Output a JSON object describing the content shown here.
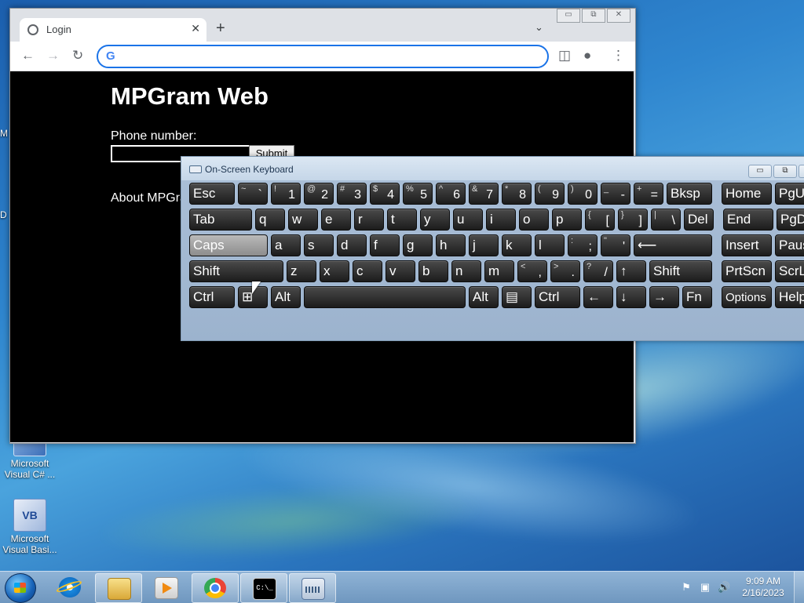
{
  "desktop": {
    "icons": [
      {
        "label": "Microsoft Visual C# ..."
      },
      {
        "label": "Microsoft Visual Basi..."
      }
    ],
    "vb_badge": "VB",
    "edge_letters": [
      "M",
      "D"
    ]
  },
  "browser": {
    "tab_title": "Login",
    "tab_close": "✕",
    "new_tab": "+",
    "tab_menu": "⌄",
    "window_buttons": {
      "minimize": "▭",
      "restore": "⧉",
      "close": "✕"
    },
    "nav": {
      "back": "←",
      "forward": "→",
      "reload": "↻"
    },
    "omnibox": {
      "g": "G",
      "value": ""
    },
    "toolbar_icons": {
      "sidebar": "◫",
      "profile": "●",
      "menu": "⋮"
    }
  },
  "page": {
    "title": "MPGram Web",
    "phone_label": "Phone number:",
    "submit": "Submit",
    "about": "About MPGram"
  },
  "osk": {
    "title": "On-Screen Keyboard",
    "buttons": {
      "minimize": "▭",
      "restore": "⧉"
    },
    "rows": [
      [
        {
          "label": "Esc",
          "w": 58
        },
        {
          "s": "~",
          "m": "`",
          "w": 38
        },
        {
          "s": "!",
          "m": "1",
          "w": 38
        },
        {
          "s": "@",
          "m": "2",
          "w": 38
        },
        {
          "s": "#",
          "m": "3",
          "w": 38
        },
        {
          "s": "$",
          "m": "4",
          "w": 38
        },
        {
          "s": "%",
          "m": "5",
          "w": 38
        },
        {
          "s": "^",
          "m": "6",
          "w": 38
        },
        {
          "s": "&",
          "m": "7",
          "w": 38
        },
        {
          "s": "*",
          "m": "8",
          "w": 38
        },
        {
          "s": "(",
          "m": "9",
          "w": 38
        },
        {
          "s": ")",
          "m": "0",
          "w": 38
        },
        {
          "s": "_",
          "m": "-",
          "w": 38
        },
        {
          "s": "+",
          "m": "=",
          "w": 38
        },
        {
          "label": "Bksp",
          "w": 58
        },
        {
          "label": "Home",
          "w": 64,
          "gap": 8
        },
        {
          "label": "PgUp",
          "w": 50
        }
      ],
      [
        {
          "label": "Tab",
          "w": 80
        },
        {
          "label": "q",
          "w": 38
        },
        {
          "label": "w",
          "w": 38
        },
        {
          "label": "e",
          "w": 38
        },
        {
          "label": "r",
          "w": 38
        },
        {
          "label": "t",
          "w": 38
        },
        {
          "label": "y",
          "w": 38
        },
        {
          "label": "u",
          "w": 38
        },
        {
          "label": "i",
          "w": 38
        },
        {
          "label": "o",
          "w": 38
        },
        {
          "label": "p",
          "w": 38
        },
        {
          "s": "{",
          "m": "[",
          "w": 38
        },
        {
          "s": "}",
          "m": "]",
          "w": 38
        },
        {
          "s": "|",
          "m": "\\",
          "w": 38
        },
        {
          "label": "Del",
          "w": 38
        },
        {
          "label": "End",
          "w": 64,
          "gap": 8
        },
        {
          "label": "PgDn",
          "w": 50
        }
      ],
      [
        {
          "label": "Caps",
          "w": 100,
          "dim": true
        },
        {
          "label": "a",
          "w": 38
        },
        {
          "label": "s",
          "w": 38
        },
        {
          "label": "d",
          "w": 38
        },
        {
          "label": "f",
          "w": 38
        },
        {
          "label": "g",
          "w": 38
        },
        {
          "label": "h",
          "w": 38
        },
        {
          "label": "j",
          "w": 38
        },
        {
          "label": "k",
          "w": 38
        },
        {
          "label": "l",
          "w": 38
        },
        {
          "s": ":",
          "m": ";",
          "w": 38
        },
        {
          "s": "\"",
          "m": "'",
          "w": 38
        },
        {
          "label": "⟵",
          "w": 100
        },
        {
          "label": "Insert",
          "w": 64,
          "gap": 8
        },
        {
          "label": "Pause",
          "w": 50
        }
      ],
      [
        {
          "label": "Shift",
          "w": 120
        },
        {
          "label": "z",
          "w": 38
        },
        {
          "label": "x",
          "w": 38
        },
        {
          "label": "c",
          "w": 38
        },
        {
          "label": "v",
          "w": 38
        },
        {
          "label": "b",
          "w": 38
        },
        {
          "label": "n",
          "w": 38
        },
        {
          "label": "m",
          "w": 38
        },
        {
          "s": "<",
          "m": ",",
          "w": 38
        },
        {
          "s": ">",
          "m": ".",
          "w": 38
        },
        {
          "s": "?",
          "m": "/",
          "w": 38
        },
        {
          "label": "↑",
          "w": 38
        },
        {
          "label": "Shift",
          "w": 80
        },
        {
          "label": "PrtScn",
          "w": 64,
          "gap": 8
        },
        {
          "label": "ScrLk",
          "w": 50
        }
      ],
      [
        {
          "label": "Ctrl",
          "w": 58
        },
        {
          "label": "⊞",
          "w": 38
        },
        {
          "label": "Alt",
          "w": 38
        },
        {
          "label": "",
          "w": 206
        },
        {
          "label": "Alt",
          "w": 38
        },
        {
          "label": "▤",
          "w": 38
        },
        {
          "label": "Ctrl",
          "w": 58
        },
        {
          "label": "←",
          "w": 38
        },
        {
          "label": "↓",
          "w": 38
        },
        {
          "label": "→",
          "w": 38
        },
        {
          "label": "Fn",
          "w": 38
        },
        {
          "label": "Options",
          "w": 64,
          "gap": 8,
          "small": true
        },
        {
          "label": "Help",
          "w": 50
        }
      ]
    ]
  },
  "taskbar": {
    "apps": [
      {
        "name": "ie",
        "active": false
      },
      {
        "name": "explorer",
        "active": true
      },
      {
        "name": "media",
        "active": false
      },
      {
        "name": "chrome",
        "active": true
      },
      {
        "name": "cmd",
        "active": true
      },
      {
        "name": "kbd",
        "active": true
      }
    ],
    "cmd_text": "C:\\_",
    "tray": {
      "flag": "⚑",
      "network": "▣",
      "volume": "🔊"
    },
    "clock": {
      "time": "9:09 AM",
      "date": "2/16/2023"
    }
  }
}
